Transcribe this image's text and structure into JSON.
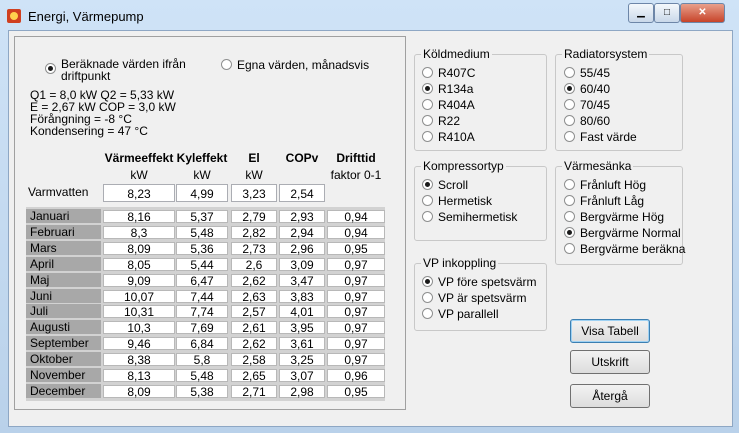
{
  "window": {
    "title": "Energi, Värmepump",
    "min": "▁",
    "max": "□",
    "close": "✕"
  },
  "mode": {
    "option1_line1": "Beräknade värden ifrån",
    "option1_line2": "driftpunkt",
    "option1_selected": true,
    "option2": "Egna värden, månadsvis"
  },
  "info": {
    "line1": "Q1 =  8,0 kW   Q2 =  5,33 kW",
    "line2": "E =  2,67 kW   COP =  3,0 kW",
    "line3": "Förångning = -8 °C",
    "line4": "Kondensering = 47 °C"
  },
  "columns": [
    {
      "label": "Värmeeffekt",
      "unit": "kW"
    },
    {
      "label": "Kyleffekt",
      "unit": "kW"
    },
    {
      "label": "El",
      "unit": "kW"
    },
    {
      "label": "COPv",
      "unit": ""
    },
    {
      "label": "Drifttid",
      "unit": "faktor 0-1"
    }
  ],
  "varmvatten": {
    "label": "Varmvatten",
    "values": [
      "8,23",
      "4,99",
      "3,23",
      "2,54"
    ]
  },
  "months": [
    {
      "name": "Januari",
      "values": [
        "8,16",
        "5,37",
        "2,79",
        "2,93",
        "0,94"
      ]
    },
    {
      "name": "Februari",
      "values": [
        "8,3",
        "5,48",
        "2,82",
        "2,94",
        "0,94"
      ]
    },
    {
      "name": "Mars",
      "values": [
        "8,09",
        "5,36",
        "2,73",
        "2,96",
        "0,95"
      ]
    },
    {
      "name": "April",
      "values": [
        "8,05",
        "5,44",
        "2,6",
        "3,09",
        "0,97"
      ]
    },
    {
      "name": "Maj",
      "values": [
        "9,09",
        "6,47",
        "2,62",
        "3,47",
        "0,97"
      ]
    },
    {
      "name": "Juni",
      "values": [
        "10,07",
        "7,44",
        "2,63",
        "3,83",
        "0,97"
      ]
    },
    {
      "name": "Juli",
      "values": [
        "10,31",
        "7,74",
        "2,57",
        "4,01",
        "0,97"
      ]
    },
    {
      "name": "Augusti",
      "values": [
        "10,3",
        "7,69",
        "2,61",
        "3,95",
        "0,97"
      ]
    },
    {
      "name": "September",
      "values": [
        "9,46",
        "6,84",
        "2,62",
        "3,61",
        "0,97"
      ]
    },
    {
      "name": "Oktober",
      "values": [
        "8,38",
        "5,8",
        "2,58",
        "3,25",
        "0,97"
      ]
    },
    {
      "name": "November",
      "values": [
        "8,13",
        "5,48",
        "2,65",
        "3,07",
        "0,96"
      ]
    },
    {
      "name": "December",
      "values": [
        "8,09",
        "5,38",
        "2,71",
        "2,98",
        "0,95"
      ]
    }
  ],
  "koldmedium": {
    "title": "Köldmedium",
    "options": [
      "R407C",
      "R134a",
      "R404A",
      "R22",
      "R410A"
    ],
    "selected": 1
  },
  "kompressortyp": {
    "title": "Kompressortyp",
    "options": [
      "Scroll",
      "Hermetisk",
      "Semihermetisk"
    ],
    "selected": 0
  },
  "vp_inkoppling": {
    "title": "VP inkoppling",
    "options": [
      "VP före spetsvärm",
      "VP är spetsvärm",
      "VP parallell"
    ],
    "selected": 0
  },
  "radiatorsystem": {
    "title": "Radiatorsystem",
    "options": [
      "55/45",
      "60/40",
      "70/45",
      "80/60",
      "Fast värde"
    ],
    "selected": 1
  },
  "varmesanka": {
    "title": "Värmesänka",
    "options": [
      "Frånluft Hög",
      "Frånluft Låg",
      "Bergvärme Hög",
      "Bergvärme Normal",
      "Bergvärme beräkna"
    ],
    "selected": 3
  },
  "buttons": {
    "visa_tabell": "Visa Tabell",
    "utskrift": "Utskrift",
    "atergå": "Återgå"
  }
}
